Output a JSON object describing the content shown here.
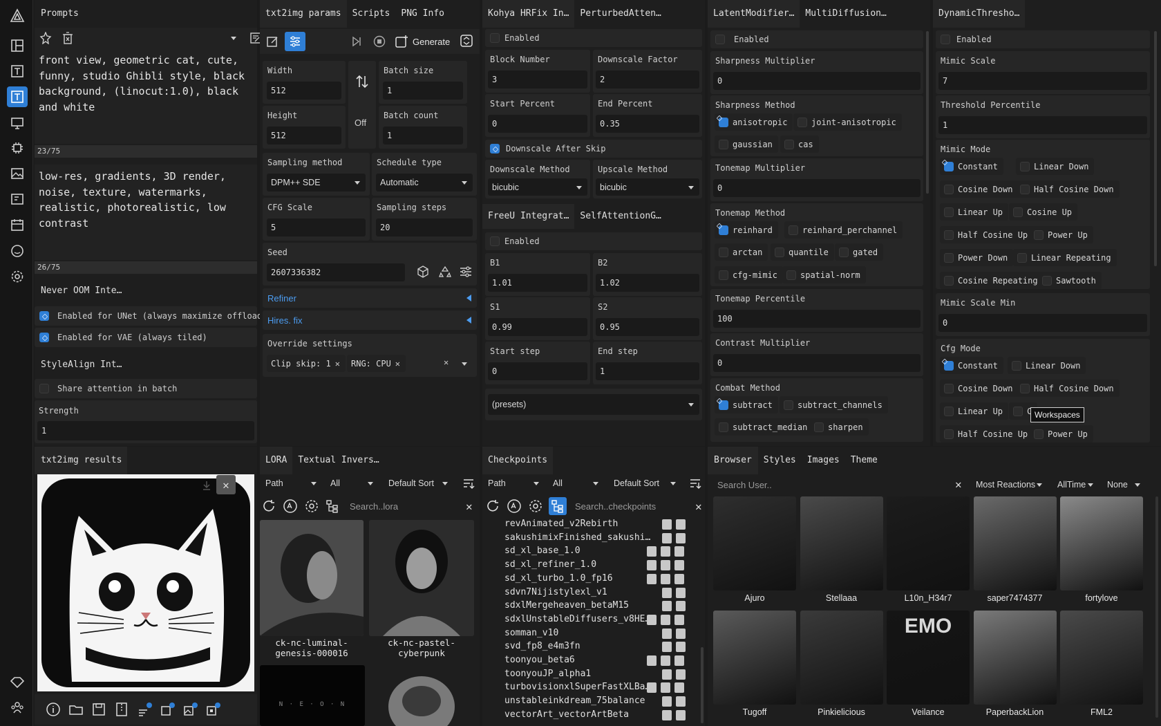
{
  "rail": {
    "items": [
      "logo-icon",
      "layout-icon",
      "text-icon",
      "text-active-icon",
      "monitor-icon",
      "cpu-icon",
      "image-icon",
      "image-edit-icon",
      "calendar-image-icon",
      "face-icon",
      "settings-icon"
    ],
    "bottom": [
      "tag-icon",
      "people-icon"
    ]
  },
  "prompts": {
    "tab": "Prompts",
    "positive": "front view, geometric cat, cute,\nfunny, studio Ghibli style, black\nbackground, (linocut:1.0), black\nand white",
    "positive_count": "23/75",
    "negative": "low-res, gradients, 3D render,\nnoise, texture, watermarks,\nrealistic, photorealistic, low\ncontrast",
    "negative_count": "26/75",
    "never_oom_tab": "Never OOM Inte…",
    "unet_label": "Enabled for UNet (always maximize offload)",
    "vae_label": "Enabled for VAE (always tiled)",
    "stylealign_tab": "StyleAlign Int…",
    "share_label": "Share attention in batch",
    "strength_label": "Strength",
    "strength_value": "1"
  },
  "params": {
    "tabs": [
      "txt2img params",
      "Scripts",
      "PNG Info"
    ],
    "generate": "Generate",
    "width_label": "Width",
    "width": "512",
    "height_label": "Height",
    "height": "512",
    "off": "Off",
    "batch_size_label": "Batch size",
    "batch_size": "1",
    "batch_count_label": "Batch count",
    "batch_count": "1",
    "sampling_method_label": "Sampling method",
    "sampling_method": "DPM++ SDE",
    "schedule_type_label": "Schedule type",
    "schedule_type": "Automatic",
    "cfg_label": "CFG Scale",
    "cfg": "5",
    "steps_label": "Sampling steps",
    "steps": "20",
    "seed_label": "Seed",
    "seed": "2607336382",
    "refiner": "Refiner",
    "hires": "Hires. fix",
    "override_label": "Override settings",
    "override_chips": [
      "Clip skip: 1",
      "RNG: CPU"
    ]
  },
  "kohya": {
    "tabs": [
      "Kohya HRFix In…",
      "PerturbedAtten…"
    ],
    "enabled": "Enabled",
    "block_label": "Block Number",
    "block": "3",
    "downscale_label": "Downscale Factor",
    "downscale": "2",
    "start_label": "Start Percent",
    "start": "0",
    "end_label": "End Percent",
    "end": "0.35",
    "after_skip": "Downscale After Skip",
    "dmethod_label": "Downscale Method",
    "dmethod": "bicubic",
    "umethod_label": "Upscale Method",
    "umethod": "bicubic",
    "freeu_tabs": [
      "FreeU Integrat…",
      "SelfAttentionG…"
    ],
    "freeu_enabled": "Enabled",
    "b1_label": "B1",
    "b1": "1.01",
    "b2_label": "B2",
    "b2": "1.02",
    "s1_label": "S1",
    "s1": "0.99",
    "s2_label": "S2",
    "s2": "0.95",
    "start_step_label": "Start step",
    "start_step": "0",
    "end_step_label": "End step",
    "end_step": "1",
    "presets": "(presets)"
  },
  "latent": {
    "tabs": [
      "LatentModifier…",
      "MultiDiffusion…"
    ],
    "enabled": "Enabled",
    "sharp_mult_label": "Sharpness Multiplier",
    "sharp_mult": "0",
    "sharp_method_label": "Sharpness Method",
    "sharp_methods": [
      "anisotropic",
      "joint-anisotropic",
      "gaussian",
      "cas"
    ],
    "tone_mult_label": "Tonemap Multiplier",
    "tone_mult": "0",
    "tone_method_label": "Tonemap Method",
    "tone_methods": [
      "reinhard",
      "reinhard_perchannel",
      "arctan",
      "quantile",
      "gated",
      "cfg-mimic",
      "spatial-norm"
    ],
    "tone_pct_label": "Tonemap Percentile",
    "tone_pct": "100",
    "contrast_label": "Contrast Multiplier",
    "contrast": "0",
    "combat_label": "Combat Method",
    "combat_methods": [
      "subtract",
      "subtract_channels",
      "subtract_median",
      "sharpen"
    ]
  },
  "dyn": {
    "tabs": [
      "DynamicThresho…"
    ],
    "enabled": "Enabled",
    "mimic_scale_label": "Mimic Scale",
    "mimic_scale": "7",
    "threshold_label": "Threshold Percentile",
    "threshold": "1",
    "mimic_mode_label": "Mimic Mode",
    "mimic_modes": [
      "Constant",
      "Linear Down",
      "Cosine Down",
      "Half Cosine Down",
      "Linear Up",
      "Cosine Up",
      "Half Cosine Up",
      "Power Up",
      "Power Down",
      "Linear Repeating",
      "Cosine Repeating",
      "Sawtooth"
    ],
    "mimic_min_label": "Mimic Scale Min",
    "mimic_min": "0",
    "cfg_mode_label": "Cfg Mode",
    "cfg_modes": [
      "Constant",
      "Linear Down",
      "Cosine Down",
      "Half Cosine Down",
      "Linear Up",
      "C",
      "Half Cosine Up",
      "Power Up"
    ],
    "tooltip": "Workspaces"
  },
  "results": {
    "tab": "txt2img results"
  },
  "lora": {
    "tabs": [
      "LORA",
      "Textual Invers…"
    ],
    "path": "Path",
    "all": "All",
    "sort": "Default Sort",
    "search_placeholder": "Search..lora",
    "cards": [
      "ck-nc-luminal-\ngenesis-000016",
      "ck-nc-pastel-\ncyberpunk"
    ],
    "neon_text": "N · E · O · N"
  },
  "checkpoints": {
    "tab": "Checkpoints",
    "path": "Path",
    "all": "All",
    "sort": "Default Sort",
    "search_placeholder": "Search..checkpoints",
    "items": [
      "revAnimated_v2Rebirth",
      "sakushimixFinished_sakushi…",
      "sd_xl_base_1.0",
      "sd_xl_refiner_1.0",
      "sd_xl_turbo_1.0_fp16",
      "sdvn7Nijistylexl_v1",
      "sdxlMergeheaven_betaM15",
      "sdxlUnstableDiffusers_v8HE…",
      "somman_v10",
      "svd_fp8_e4m3fn",
      "toonyou_beta6",
      "toonyouJP_alpha1",
      "turbovisionxlSuperFastXLBa…",
      "unstableinkdream_75balance",
      "vectorArt_vectorArtBeta"
    ]
  },
  "browser": {
    "tabs": [
      "Browser",
      "Styles",
      "Images",
      "Theme"
    ],
    "search_placeholder": "Search User..",
    "sort": "Most Reactions",
    "period": "AllTime",
    "filter": "None",
    "users": [
      "Ajuro",
      "Stellaaa",
      "L10n_H34r7",
      "saper7474377",
      "fortylove",
      "Tugoff",
      "Pinkielicious",
      "Veilance",
      "PaperbackLion",
      "FML2"
    ],
    "emo_text": "EMO"
  }
}
